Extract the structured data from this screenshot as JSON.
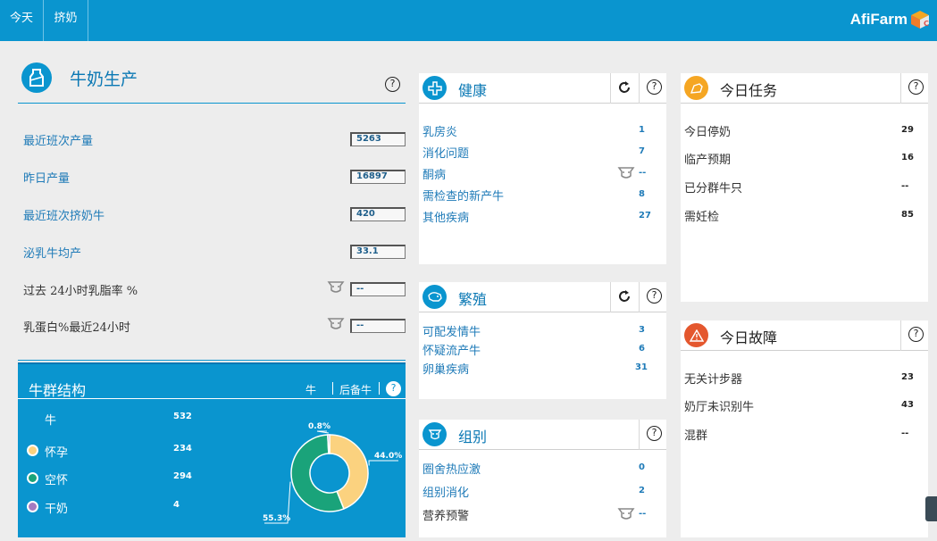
{
  "topbar": {
    "tabs": [
      "今天",
      "挤奶"
    ],
    "logo": "AfiFarm",
    "color": "#0a95cf"
  },
  "milk": {
    "title": "牛奶生产",
    "help": "?",
    "rows": [
      {
        "label": "最近班次产量",
        "value": "5263"
      },
      {
        "label": "昨日产量",
        "value": "16897"
      },
      {
        "label": "最近班次挤奶牛",
        "value": "420"
      },
      {
        "label": "泌乳牛均产",
        "value": "33.1"
      },
      {
        "label": "过去 24小时乳脂率 %",
        "value": "--"
      },
      {
        "label": "乳蛋白%最近24小时",
        "value": "--"
      }
    ]
  },
  "herd": {
    "title": "牛群结构",
    "tabs": [
      "牛",
      "后备牛"
    ],
    "help": "?",
    "total_label": "牛",
    "total_value": "532",
    "groups": [
      {
        "name": "怀孕",
        "value": "234",
        "color": "#fbd27f"
      },
      {
        "name": "空怀",
        "value": "294",
        "color": "#1aa37a"
      },
      {
        "name": "干奶",
        "value": "4",
        "color": "#a57bc0"
      }
    ],
    "chart_data": {
      "type": "pie",
      "categories": [
        "怀孕",
        "空怀",
        "干奶"
      ],
      "values": [
        44.0,
        55.3,
        0.8
      ],
      "labels": [
        "44.0%",
        "55.3%",
        "0.8%"
      ]
    }
  },
  "health": {
    "title": "健康",
    "help": "?",
    "items": [
      {
        "label": "乳房炎",
        "value": "1"
      },
      {
        "label": "消化问题",
        "value": "7"
      },
      {
        "label": "酮病",
        "value": "--"
      },
      {
        "label": "需检查的新产牛",
        "value": "8"
      },
      {
        "label": "其他疾病",
        "value": "27"
      }
    ]
  },
  "breeding": {
    "title": "繁殖",
    "help": "?",
    "items": [
      {
        "label": "可配发情牛",
        "value": "3"
      },
      {
        "label": "怀疑流产牛",
        "value": "6"
      },
      {
        "label": "卵巢疾病",
        "value": "31"
      }
    ]
  },
  "groups": {
    "title": "组别",
    "help": "?",
    "items": [
      {
        "label": "圈舍热应激",
        "value": "0"
      },
      {
        "label": "组别消化",
        "value": "2"
      },
      {
        "label": "营养预警",
        "value": "--"
      }
    ]
  },
  "tasks": {
    "title": "今日任务",
    "help": "?",
    "items": [
      {
        "label": "今日停奶",
        "value": "29"
      },
      {
        "label": "临产预期",
        "value": "16"
      },
      {
        "label": "已分群牛只",
        "value": "--"
      },
      {
        "label": "需妊检",
        "value": "85"
      }
    ]
  },
  "faults": {
    "title": "今日故障",
    "help": "?",
    "items": [
      {
        "label": "无关计步器",
        "value": "23"
      },
      {
        "label": "奶厅未识别牛",
        "value": "43"
      },
      {
        "label": "混群",
        "value": "--"
      }
    ]
  }
}
